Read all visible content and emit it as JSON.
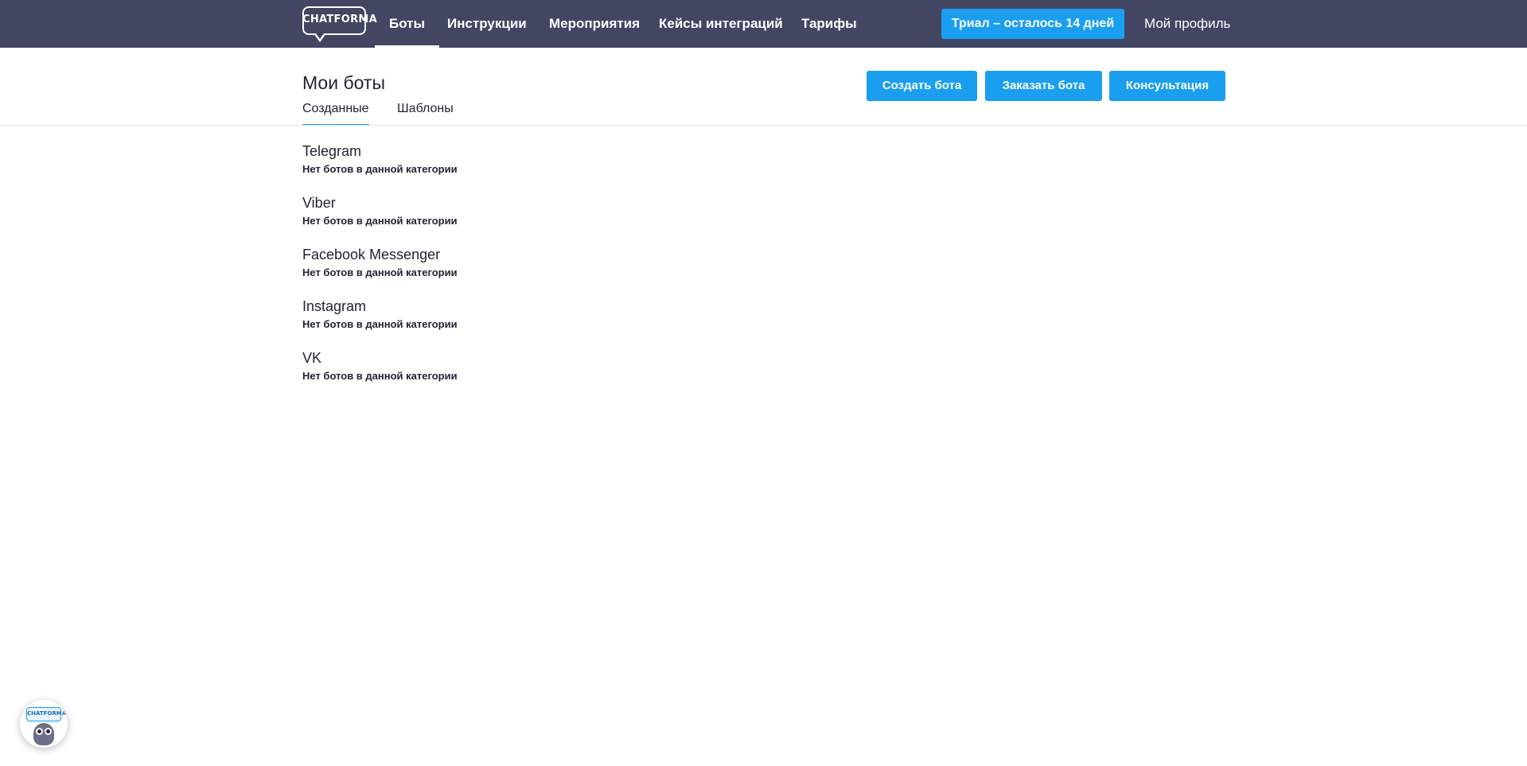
{
  "navbar": {
    "logo_text": "CHATFORMA",
    "links": [
      {
        "label": "Боты",
        "active": true
      },
      {
        "label": "Инструкции",
        "active": false
      },
      {
        "label": "Мероприятия",
        "active": false
      },
      {
        "label": "Кейсы интеграций",
        "active": false
      },
      {
        "label": "Тарифы",
        "active": false
      }
    ],
    "trial_label": "Триал – осталось 14 дней",
    "profile_label": "Мой профиль"
  },
  "page": {
    "title": "Мои боты",
    "tabs": [
      {
        "label": "Созданные",
        "active": true
      },
      {
        "label": "Шаблоны",
        "active": false
      }
    ],
    "actions": {
      "create_label": "Создать бота",
      "order_label": "Заказать бота",
      "consult_label": "Консультация"
    }
  },
  "categories": [
    {
      "name": "Telegram",
      "empty_text": "Нет ботов в данной категории"
    },
    {
      "name": "Viber",
      "empty_text": "Нет ботов в данной категории"
    },
    {
      "name": "Facebook Messenger",
      "empty_text": "Нет ботов в данной категории"
    },
    {
      "name": "Instagram",
      "empty_text": "Нет ботов в данной категории"
    },
    {
      "name": "VK",
      "empty_text": "Нет ботов в данной категории"
    }
  ],
  "widget": {
    "logo_text": "CHATFORMA",
    "icon": "chatforma-owl-icon"
  },
  "colors": {
    "navbar_bg": "#424663",
    "accent": "#1a9ef0",
    "text": "#1f2233"
  }
}
